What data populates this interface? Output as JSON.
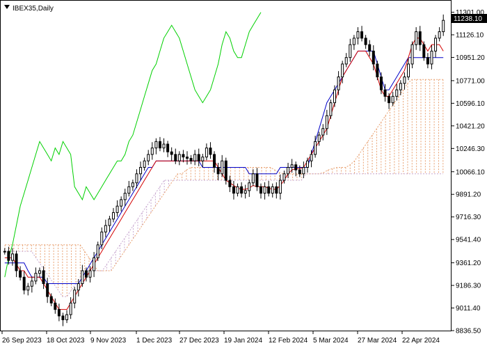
{
  "chart_data": {
    "type": "candlestick",
    "title": "IBEX35,Daily",
    "current_price_label": "11238.10",
    "ylim": [
      8836.5,
      11390
    ],
    "y_ticks": [
      "11301.00",
      "11126.10",
      "10951.20",
      "10771.00",
      "10596.10",
      "10421.20",
      "10246.30",
      "10066.10",
      "9891.20",
      "9716.30",
      "9541.40",
      "9361.20",
      "9186.30",
      "9011.40",
      "8836.50"
    ],
    "x_ticks": [
      "26 Sep 2023",
      "18 Oct 2023",
      "9 Nov 2023",
      "1 Dec 2023",
      "27 Dec 2023",
      "19 Jan 2024",
      "12 Feb 2024",
      "5 Mar 2024",
      "27 Mar 2024",
      "22 Apr 2024"
    ],
    "colors": {
      "tenkan": "#d40000",
      "kijun": "#0000c8",
      "chikou": "#00d000",
      "cloud_up": "#e8a070",
      "cloud_down": "#c8a8d0",
      "candle": "#000000",
      "grid": "#000000"
    },
    "series_data": {
      "closes": [
        9450,
        9380,
        9430,
        9300,
        9250,
        9150,
        9180,
        9220,
        9280,
        9300,
        9200,
        9100,
        9050,
        9000,
        8950,
        8920,
        8960,
        9050,
        9150,
        9200,
        9300,
        9250,
        9300,
        9400,
        9500,
        9600,
        9650,
        9700,
        9750,
        9800,
        9850,
        9900,
        9950,
        9980,
        10050,
        10100,
        10150,
        10200,
        10250,
        10300,
        10250,
        10280,
        10220,
        10200,
        10150,
        10200,
        10180,
        10170,
        10150,
        10200,
        10150,
        10180,
        10250,
        10200,
        10100,
        10050,
        10150,
        10000,
        9950,
        9900,
        9950,
        9900,
        9920,
        9980,
        10050,
        9950,
        9900,
        9950,
        9900,
        9950,
        9900,
        10000,
        10050,
        10100,
        10120,
        10080,
        10050,
        10100,
        10150,
        10200,
        10300,
        10350,
        10400,
        10500,
        10600,
        10700,
        10800,
        10900,
        10950,
        11050,
        11100,
        11150,
        11100,
        11050,
        11000,
        10900,
        10800,
        10700,
        10650,
        10600,
        10650,
        10700,
        10750,
        10800,
        10900,
        11050,
        11150,
        11050,
        10950,
        10900,
        11000,
        11100,
        11150,
        11238
      ]
    },
    "ichimoku_lines": {
      "tenkan": [
        9400,
        9400,
        9400,
        9350,
        9300,
        9300,
        9250,
        9250,
        9250,
        9250,
        9200,
        9150,
        9100,
        9050,
        9000,
        9000,
        9000,
        9050,
        9100,
        9150,
        9200,
        9250,
        9300,
        9350,
        9400,
        9450,
        9500,
        9550,
        9600,
        9650,
        9700,
        9750,
        9800,
        9850,
        9900,
        9950,
        10000,
        10050,
        10100,
        10150,
        10150,
        10150,
        10150,
        10150,
        10150,
        10150,
        10150,
        10150,
        10150,
        10150,
        10150,
        10150,
        10150,
        10150,
        10150,
        10100,
        10050,
        10000,
        9980,
        9960,
        9940,
        9930,
        9930,
        9940,
        9960,
        9950,
        9950,
        9950,
        9940,
        9930,
        9930,
        9960,
        10000,
        10050,
        10080,
        10090,
        10090,
        10100,
        10150,
        10200,
        10250,
        10300,
        10350,
        10400,
        10500,
        10600,
        10700,
        10800,
        10850,
        10900,
        10950,
        11000,
        11000,
        11000,
        10950,
        10900,
        10800,
        10700,
        10650,
        10650,
        10700,
        10750,
        10800,
        10850,
        10950,
        11050,
        11100,
        11100,
        11050,
        11000,
        11050,
        11050,
        11050,
        11000
      ],
      "kijun": [
        9360,
        9360,
        9360,
        9360,
        9360,
        9360,
        9300,
        9250,
        9250,
        9250,
        9250,
        9200,
        9200,
        9200,
        9200,
        9200,
        9200,
        9200,
        9200,
        9200,
        9250,
        9300,
        9350,
        9400,
        9450,
        9500,
        9550,
        9600,
        9650,
        9700,
        9750,
        9800,
        9850,
        9900,
        9950,
        10000,
        10050,
        10100,
        10100,
        10150,
        10150,
        10150,
        10150,
        10150,
        10150,
        10150,
        10150,
        10150,
        10150,
        10150,
        10150,
        10100,
        10100,
        10100,
        10100,
        10100,
        10100,
        10100,
        10100,
        10100,
        10100,
        10100,
        10100,
        10050,
        10050,
        10050,
        10050,
        10050,
        10050,
        10050,
        10050,
        10100,
        10100,
        10100,
        10100,
        10100,
        10100,
        10100,
        10100,
        10200,
        10300,
        10400,
        10500,
        10600,
        10650,
        10700,
        10750,
        10800,
        10850,
        10900,
        10950,
        11000,
        11000,
        11000,
        11000,
        11000,
        10900,
        10800,
        10700,
        10700,
        10750,
        10800,
        10850,
        10900,
        10950,
        10950,
        10950,
        10950,
        10950,
        10950,
        10950,
        10950,
        10950,
        10950
      ],
      "chikou": [
        9250,
        9400,
        9500,
        9650,
        9800,
        9900,
        10000,
        10100,
        10200,
        10300,
        10250,
        10200,
        10150,
        10250,
        10200,
        10300,
        10250,
        10200,
        9950,
        9900,
        9850,
        9950,
        9900,
        9850,
        9900,
        9950,
        10000,
        10050,
        10100,
        10150,
        10150,
        10200,
        10300,
        10350,
        10450,
        10550,
        10650,
        10750,
        10850,
        10900,
        11000,
        11100,
        11150,
        11200,
        11150,
        11100,
        11000,
        10900,
        10800,
        10700,
        10650,
        10600,
        10650,
        10700,
        10800,
        10900,
        11050,
        11150,
        11100,
        11000,
        10950,
        10950,
        11050,
        11150,
        11200,
        11250,
        11300
      ]
    },
    "cloud": {
      "span_a": [
        9500,
        9500,
        9500,
        9500,
        9500,
        9500,
        9500,
        9500,
        9500,
        9500,
        9500,
        9500,
        9500,
        9500,
        9500,
        9500,
        9500,
        9500,
        9450,
        9400,
        9350,
        9300,
        9300,
        9300,
        9300,
        9350,
        9400,
        9450,
        9500,
        9550,
        9600,
        9650,
        9700,
        9750,
        9800,
        9850,
        9900,
        9950,
        10000,
        10050,
        10050,
        10080,
        10100,
        10100,
        10100,
        10100,
        10100,
        10100,
        10100,
        10100,
        10100,
        10100,
        10100,
        10100,
        10100,
        10100,
        10100,
        10100,
        10100,
        10100,
        10100,
        10080,
        10060,
        10050,
        10050,
        10050,
        10050,
        10050,
        10050,
        10050,
        10050,
        10050,
        10060,
        10080,
        10090,
        10100,
        10100,
        10100,
        10120,
        10150,
        10200,
        10250,
        10300,
        10350,
        10400,
        10450,
        10500,
        10550,
        10600,
        10650,
        10700,
        10750,
        10780,
        10780,
        10780,
        10780,
        10780,
        10780,
        10780,
        10780
      ],
      "span_b": [
        9450,
        9450,
        9450,
        9450,
        9450,
        9450,
        9450,
        9400,
        9350,
        9300,
        9250,
        9200,
        9150,
        9100,
        9100,
        9150,
        9200,
        9250,
        9300,
        9300,
        9300,
        9300,
        9300,
        9350,
        9400,
        9450,
        9500,
        9550,
        9600,
        9650,
        9700,
        9750,
        9800,
        9850,
        9900,
        9950,
        10000,
        10000,
        10000,
        10000,
        10000,
        10000,
        10000,
        10000,
        10000,
        10000,
        10000,
        10000,
        10000,
        10000,
        10000,
        10000,
        10000,
        10000,
        10000,
        10000,
        10000,
        10000,
        10000,
        10000,
        10000,
        10000,
        10000,
        10000,
        10000,
        10000,
        10000,
        10000,
        10050,
        10050,
        10050,
        10050,
        10050,
        10050,
        10050,
        10050,
        10050,
        10050,
        10050,
        10050,
        10050,
        10050,
        10050,
        10050,
        10050,
        10050,
        10050,
        10050,
        10050,
        10050,
        10050,
        10050,
        10050,
        10050,
        10050,
        10050,
        10050,
        10050,
        10050,
        10050
      ]
    }
  }
}
